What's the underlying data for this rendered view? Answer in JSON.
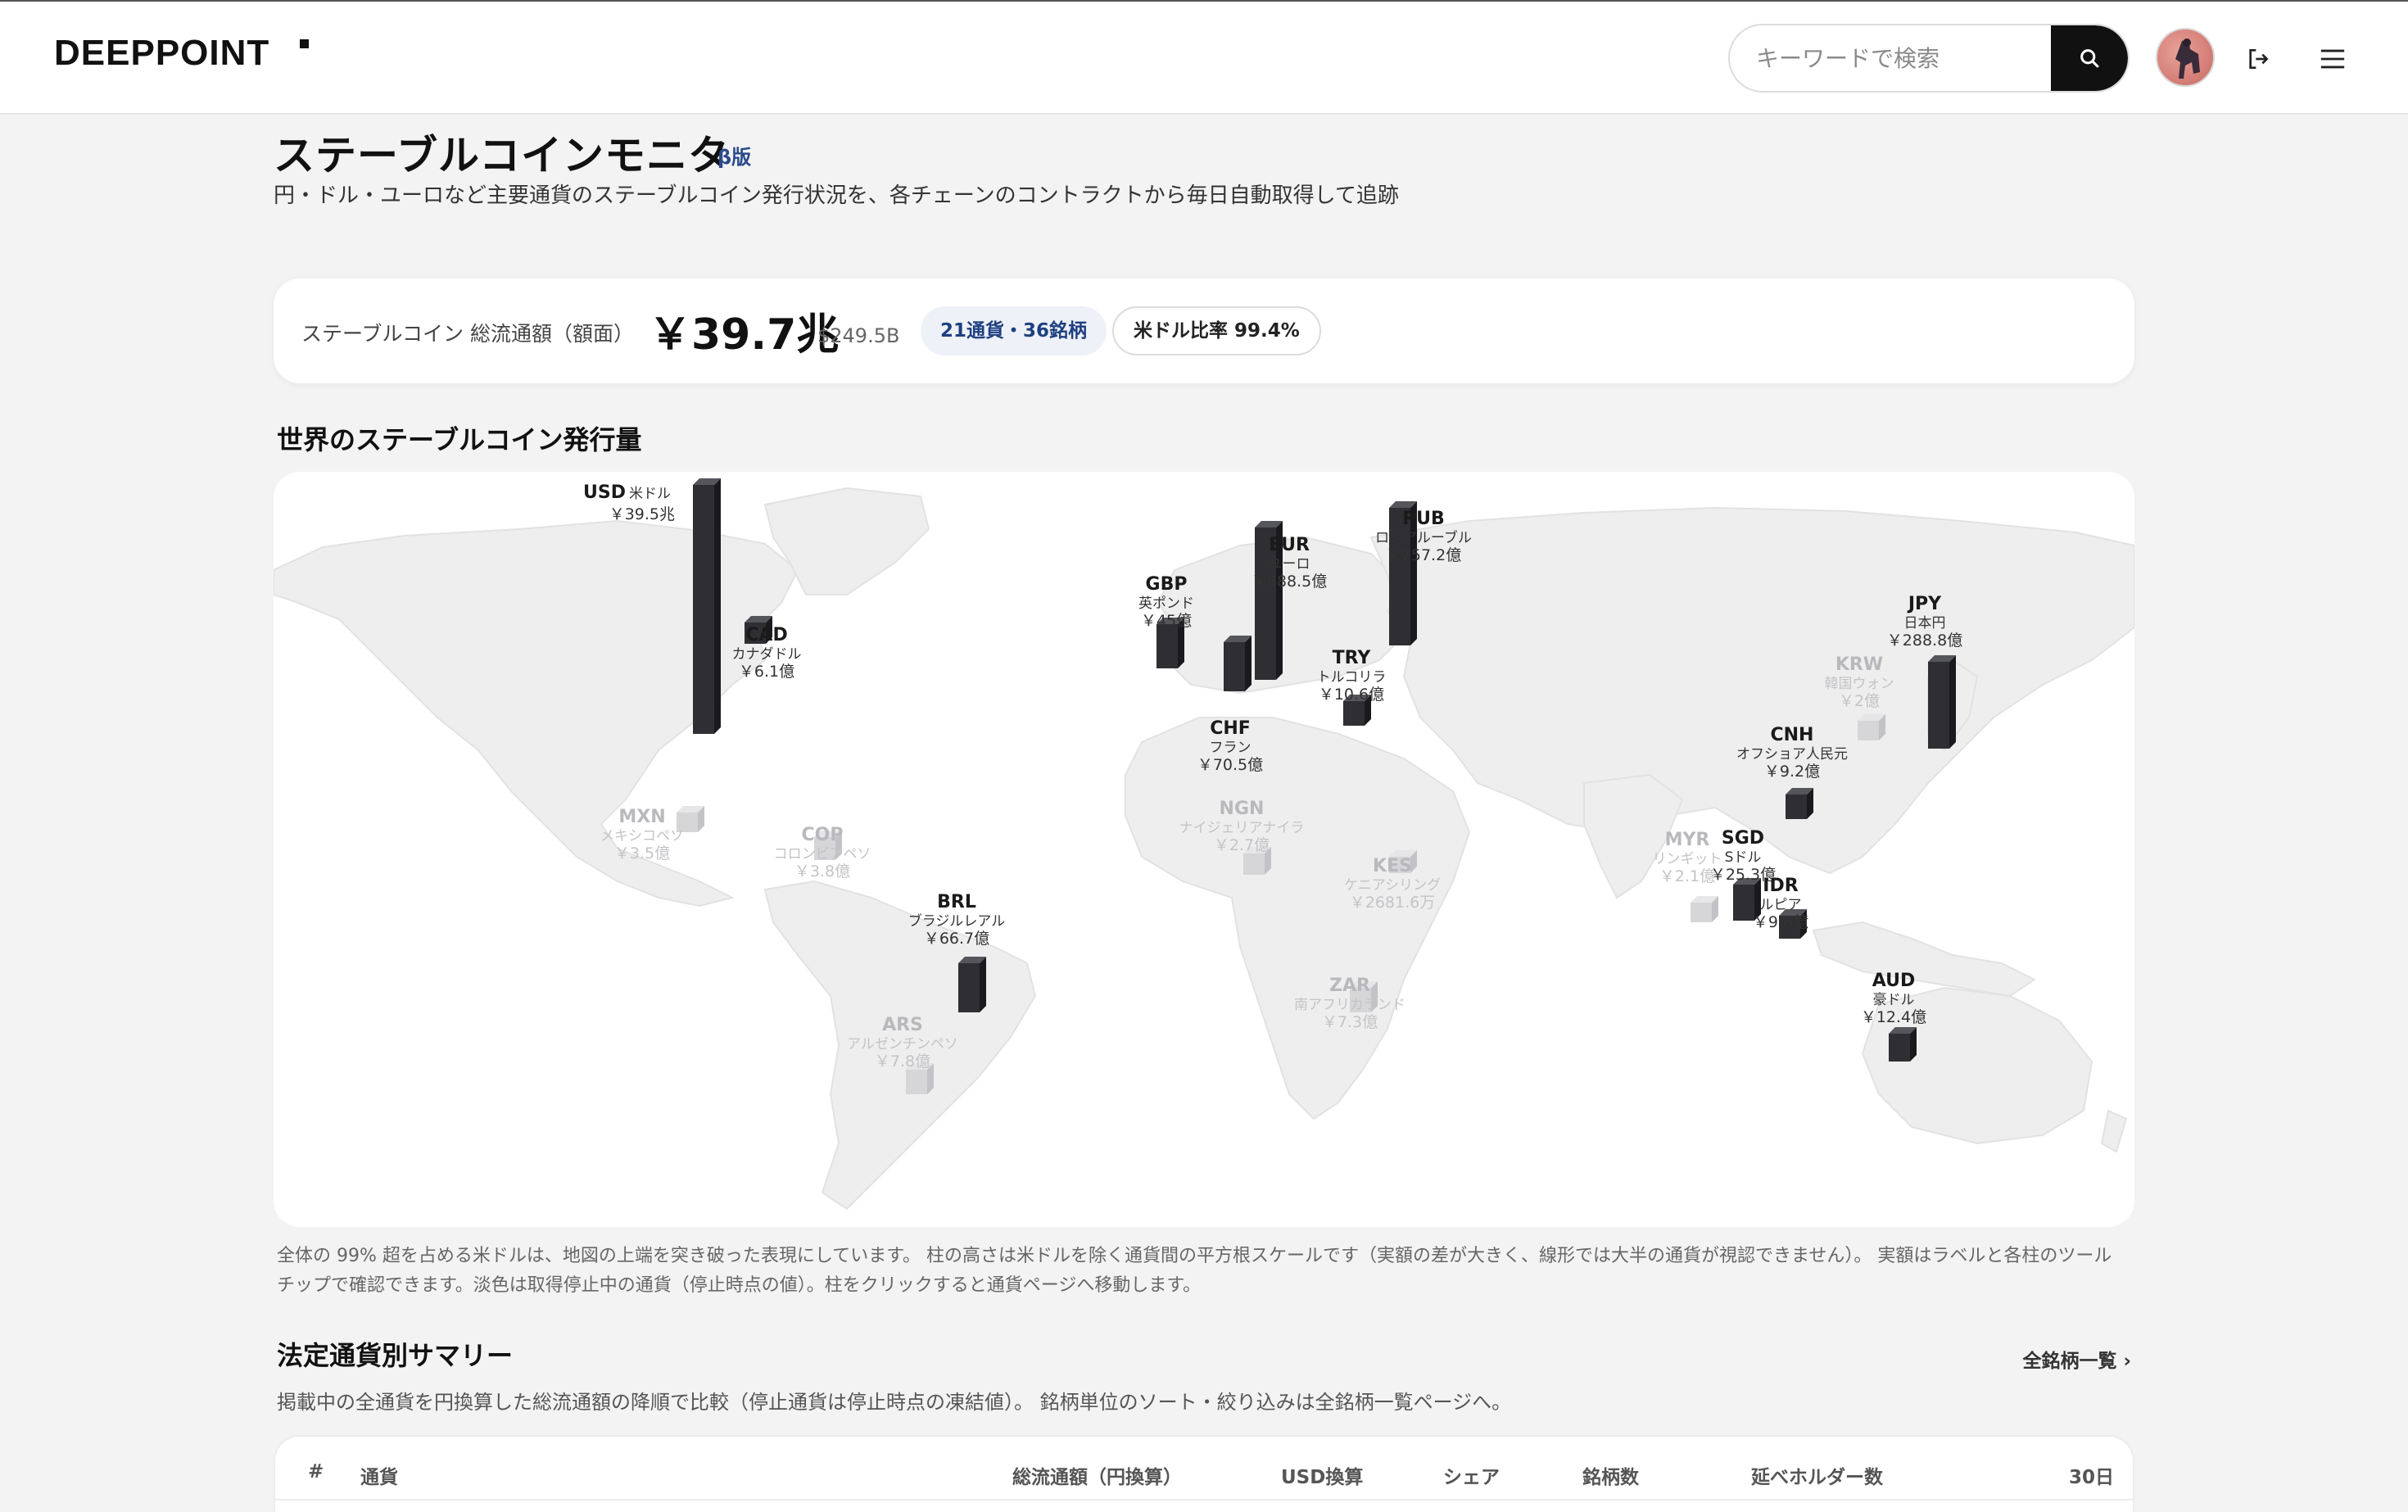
{
  "header": {
    "logo": "DEEPPOINT",
    "search_placeholder": "キーワードで検索",
    "icons": [
      "search-icon",
      "avatar",
      "logout-icon",
      "menu-icon"
    ]
  },
  "page": {
    "title": "ステーブルコインモニタ",
    "beta": "β版",
    "subtitle": "円・ドル・ユーロなど主要通貨のステーブルコイン発行状況を、各チェーンのコントラクトから毎日自動取得して追跡"
  },
  "summary": {
    "label": "ステーブルコイン 総流通額（額面）",
    "value": "￥39.7兆",
    "usd": "$249.5B",
    "count_pill": "21通貨・36銘柄",
    "usd_ratio_pill": "米ドル比率 99.4%"
  },
  "map_section": {
    "heading": "世界のステーブルコイン発行量",
    "note": "全体の 99% 超を占める米ドルは、地図の上端を突き破った表現にしています。 柱の高さは米ドルを除く通貨間の平方根スケールです（実額の差が大きく、線形では大半の通貨が視認できません）。 実額はラベルと各柱のツールチップで確認できます。淡色は取得停止中の通貨（停止時点の値）。柱をクリックすると通貨ページへ移動します。"
  },
  "currencies": [
    {
      "code": "USD",
      "name": "米ドル",
      "amount": "￥39.5兆",
      "active": true
    },
    {
      "code": "CAD",
      "name": "カナダドル",
      "amount": "￥6.1億",
      "active": true
    },
    {
      "code": "GBP",
      "name": "英ポンド",
      "amount": "￥45億",
      "active": true
    },
    {
      "code": "EUR",
      "name": "ユーロ",
      "amount": "￥888.5億",
      "active": true
    },
    {
      "code": "RUB",
      "name": "ロシアルーブル",
      "amount": "￥757.2億",
      "active": true
    },
    {
      "code": "CHF",
      "name": "フラン",
      "amount": "￥70.5億",
      "active": true
    },
    {
      "code": "TRY",
      "name": "トルコリラ",
      "amount": "￥10.6億",
      "active": true
    },
    {
      "code": "JPY",
      "name": "日本円",
      "amount": "￥288.8億",
      "active": true
    },
    {
      "code": "KRW",
      "name": "韓国ウォン",
      "amount": "￥2億",
      "active": false
    },
    {
      "code": "CNH",
      "name": "オフショア人民元",
      "amount": "￥9.2億",
      "active": true
    },
    {
      "code": "MXN",
      "name": "メキシコペソ",
      "amount": "￥3.5億",
      "active": false
    },
    {
      "code": "COP",
      "name": "コロンビアペソ",
      "amount": "￥3.8億",
      "active": false
    },
    {
      "code": "NGN",
      "name": "ナイジェリアナイラ",
      "amount": "￥2.7億",
      "active": false
    },
    {
      "code": "KES",
      "name": "ケニアシリング",
      "amount": "￥2681.6万",
      "active": false
    },
    {
      "code": "MYR",
      "name": "リンギット",
      "amount": "￥2.1億",
      "active": false
    },
    {
      "code": "SGD",
      "name": "Sドル",
      "amount": "￥25.3億",
      "active": true
    },
    {
      "code": "IDR",
      "name": "ルピア",
      "amount": "￥9.6億",
      "active": true
    },
    {
      "code": "BRL",
      "name": "ブラジルレアル",
      "amount": "￥66.7億",
      "active": true
    },
    {
      "code": "ZAR",
      "name": "南アフリカランド",
      "amount": "￥7.3億",
      "active": false
    },
    {
      "code": "ARS",
      "name": "アルゼンチンペソ",
      "amount": "￥7.8億",
      "active": false
    },
    {
      "code": "AUD",
      "name": "豪ドル",
      "amount": "￥12.4億",
      "active": true
    }
  ],
  "table_section": {
    "heading": "法定通貨別サマリー",
    "link_all": "全銘柄一覧 ›",
    "note": "掲載中の全通貨を円換算した総流通額の降順で比較（停止通貨は停止時点の凍結値）。 銘柄単位のソート・絞り込みは全銘柄一覧ページへ。",
    "columns": [
      "#",
      "通貨",
      "総流通額（円換算）",
      "USD換算",
      "シェア",
      "銘柄数",
      "延べホルダー数",
      "30日"
    ]
  },
  "colors": {
    "bar_active": "#2e2e33",
    "bar_inactive": "#d6d6d9",
    "map_land": "#eeeeee",
    "accent_blue": "#1e3f80"
  }
}
